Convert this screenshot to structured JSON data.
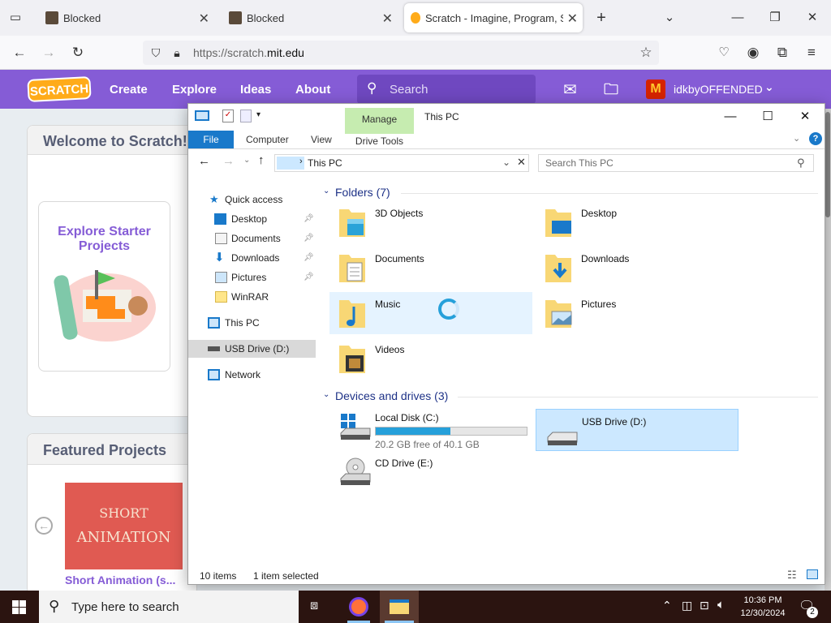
{
  "browser": {
    "tabs": [
      {
        "title": "Blocked"
      },
      {
        "title": "Blocked"
      },
      {
        "title": "Scratch - Imagine, Program, Sh"
      }
    ],
    "new_tab_symbol": "+",
    "url_prefix": "https://scratch.",
    "url_domain": "mit.edu"
  },
  "scratch": {
    "logo": "SCRATCH",
    "nav": [
      "Create",
      "Explore",
      "Ideas",
      "About"
    ],
    "search_placeholder": "Search",
    "username": "idkbyOFFENDED",
    "welcome_title": "Welcome to Scratch!",
    "starter_line1": "Explore Starter",
    "starter_line2": "Projects",
    "featured_title": "Featured Projects",
    "thumb_line1": "SHORT",
    "thumb_line2": "ANIMATION",
    "project_title": "Short Animation (s...",
    "accent": "#855cd6"
  },
  "explorer": {
    "title": "This PC",
    "ribbon": {
      "file": "File",
      "computer": "Computer",
      "view": "View",
      "manage": "Manage",
      "drive_tools": "Drive Tools"
    },
    "address": "This PC",
    "search_placeholder": "Search This PC",
    "nav": {
      "quick_access": "Quick access",
      "desktop": "Desktop",
      "documents": "Documents",
      "downloads": "Downloads",
      "pictures": "Pictures",
      "winrar": "WinRAR",
      "this_pc": "This PC",
      "usb": "USB Drive (D:)",
      "network": "Network"
    },
    "folders_header": "Folders (7)",
    "folders": [
      "3D Objects",
      "Desktop",
      "Documents",
      "Downloads",
      "Music",
      "Pictures",
      "Videos"
    ],
    "devices_header": "Devices and drives (3)",
    "drives": {
      "c_name": "Local Disk (C:)",
      "c_free": "20.2 GB free of 40.1 GB",
      "c_used_fraction": 0.496,
      "d_name": "USB Drive (D:)",
      "e_name": "CD Drive (E:)"
    },
    "status_count": "10 items",
    "status_selected": "1 item selected"
  },
  "taskbar": {
    "search_placeholder": "Type here to search",
    "time": "10:36 PM",
    "date": "12/30/2024",
    "notification_count": "2"
  }
}
